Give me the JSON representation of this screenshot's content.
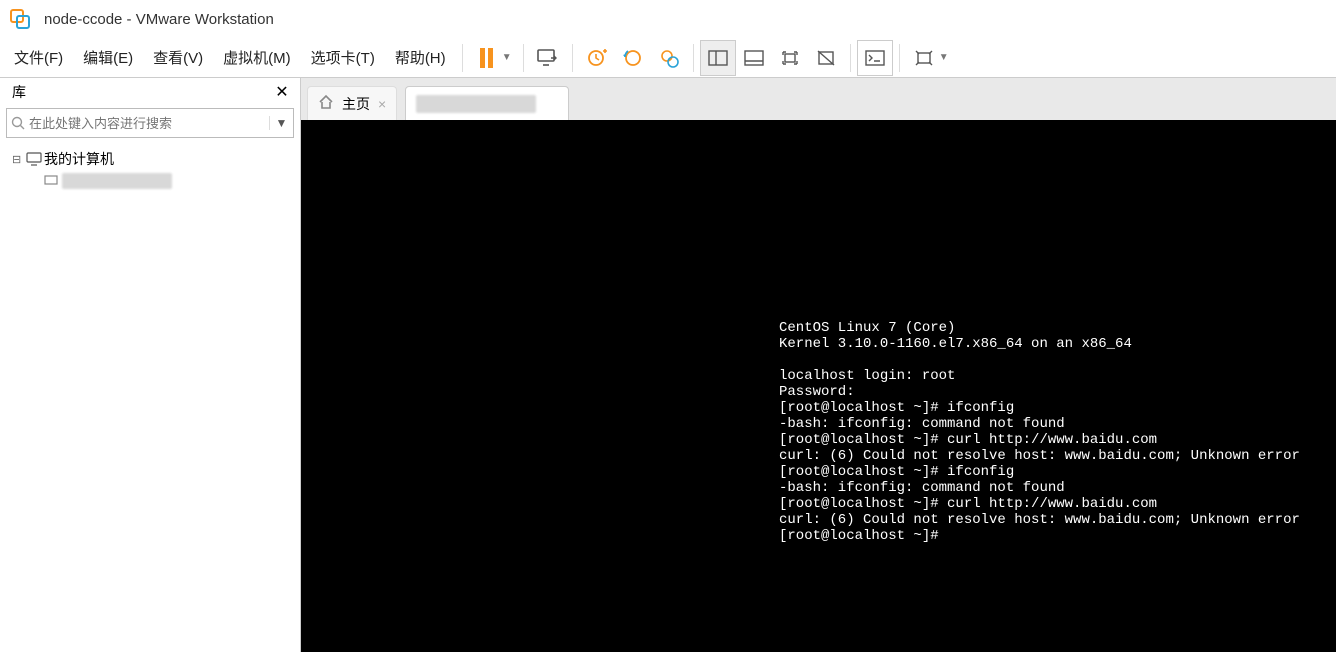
{
  "titlebar": {
    "title": "node-ccode - VMware Workstation"
  },
  "menu": {
    "file": "文件(F)",
    "edit": "编辑(E)",
    "view": "查看(V)",
    "vm": "虚拟机(M)",
    "tabs": "选项卡(T)",
    "help": "帮助(H)"
  },
  "sidebar": {
    "header": "库",
    "search_placeholder": "在此处键入内容进行搜索",
    "root": "我的计算机"
  },
  "tabs": {
    "home_label": "主页"
  },
  "console_lines": [
    "CentOS Linux 7 (Core)",
    "Kernel 3.10.0-1160.el7.x86_64 on an x86_64",
    "",
    "localhost login: root",
    "Password:",
    "[root@localhost ~]# ifconfig",
    "-bash: ifconfig: command not found",
    "[root@localhost ~]# curl http://www.baidu.com",
    "curl: (6) Could not resolve host: www.baidu.com; Unknown error",
    "[root@localhost ~]# ifconfig",
    "-bash: ifconfig: command not found",
    "[root@localhost ~]# curl http://www.baidu.com",
    "curl: (6) Could not resolve host: www.baidu.com; Unknown error",
    "[root@localhost ~]#"
  ]
}
